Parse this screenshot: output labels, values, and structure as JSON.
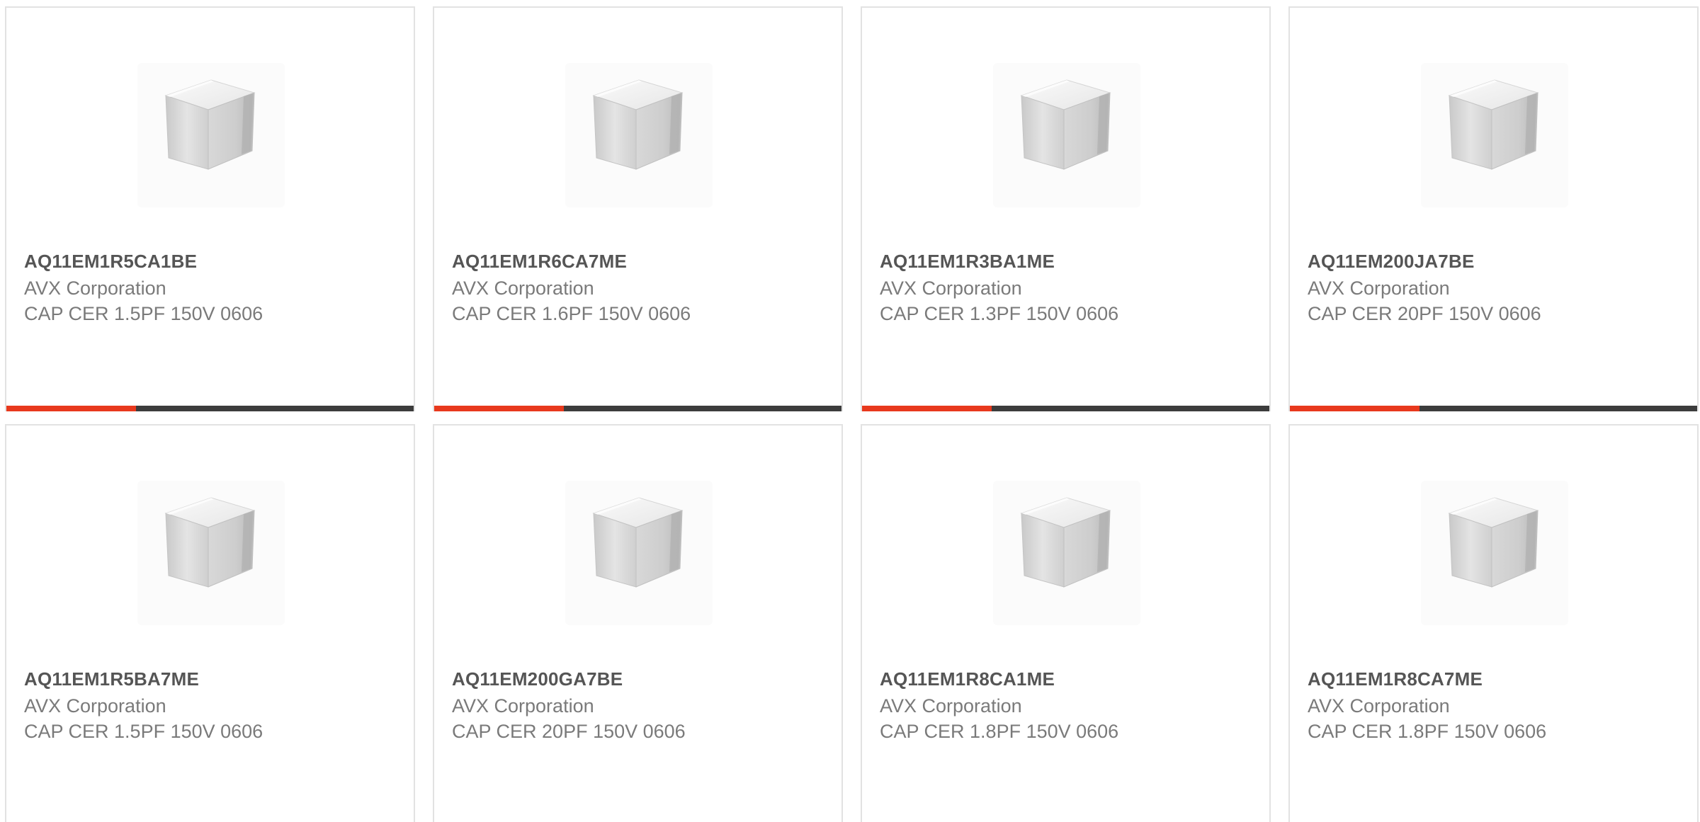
{
  "products": [
    {
      "part_number": "AQ11EM1R5CA1BE",
      "manufacturer": "AVX Corporation",
      "description": "CAP CER 1.5PF 150V 0606"
    },
    {
      "part_number": "AQ11EM1R6CA7ME",
      "manufacturer": "AVX Corporation",
      "description": "CAP CER 1.6PF 150V 0606"
    },
    {
      "part_number": "AQ11EM1R3BA1ME",
      "manufacturer": "AVX Corporation",
      "description": "CAP CER 1.3PF 150V 0606"
    },
    {
      "part_number": "AQ11EM200JA7BE",
      "manufacturer": "AVX Corporation",
      "description": "CAP CER 20PF 150V 0606"
    },
    {
      "part_number": "AQ11EM1R5BA7ME",
      "manufacturer": "AVX Corporation",
      "description": "CAP CER 1.5PF 150V 0606"
    },
    {
      "part_number": "AQ11EM200GA7BE",
      "manufacturer": "AVX Corporation",
      "description": "CAP CER 20PF 150V 0606"
    },
    {
      "part_number": "AQ11EM1R8CA1ME",
      "manufacturer": "AVX Corporation",
      "description": "CAP CER 1.8PF 150V 0606"
    },
    {
      "part_number": "AQ11EM1R8CA7ME",
      "manufacturer": "AVX Corporation",
      "description": "CAP CER 1.8PF 150V 0606"
    }
  ],
  "colors": {
    "accent": "#e8391d",
    "bar": "#3c3c3c",
    "border": "#e2e2e2",
    "title_text": "#555555",
    "body_text": "#7a7a7a"
  },
  "icons": {
    "product_image": "ceramic-capacitor-chip-icon"
  }
}
